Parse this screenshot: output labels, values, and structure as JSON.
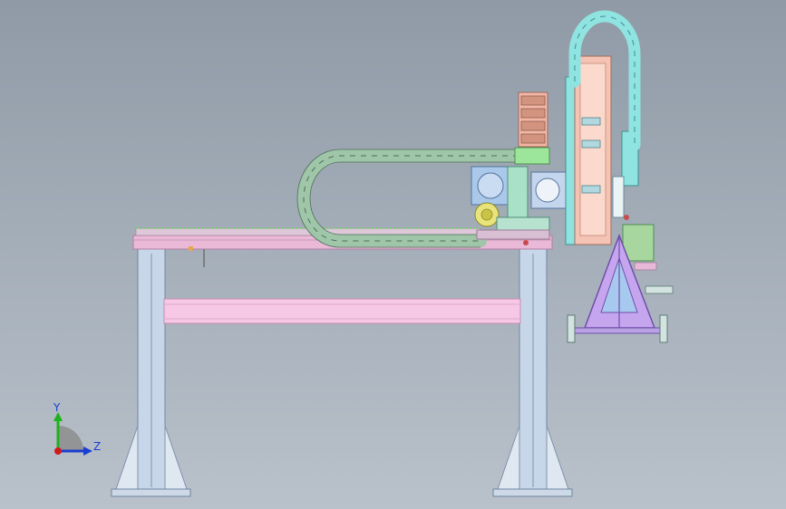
{
  "viewport": {
    "background_top": "#8f9aa6",
    "background_bottom": "#b9c1ca"
  },
  "colors": {
    "frame_pink": "#e9b8d6",
    "frame_pink_dark": "#c98fb6",
    "beam_pink": "#f4c3e3",
    "leg_blue": "#bfd2e6",
    "leg_blue_dark": "#8ea6c1",
    "cable_chain": "#9fc9a8",
    "cable_chain_cyan": "#8fe3e0",
    "vertical_frame": "#f2c1b1",
    "motor_blue": "#9fc3e8",
    "gear_yellow": "#e8e37a",
    "gripper_purple": "#b896e8",
    "green_block": "#9be39a",
    "axis_y": "#1db31d",
    "axis_z": "#1a3fcf",
    "axis_x": "#d11b1b"
  },
  "triad": {
    "y_label": "Y",
    "z_label": "Z"
  }
}
